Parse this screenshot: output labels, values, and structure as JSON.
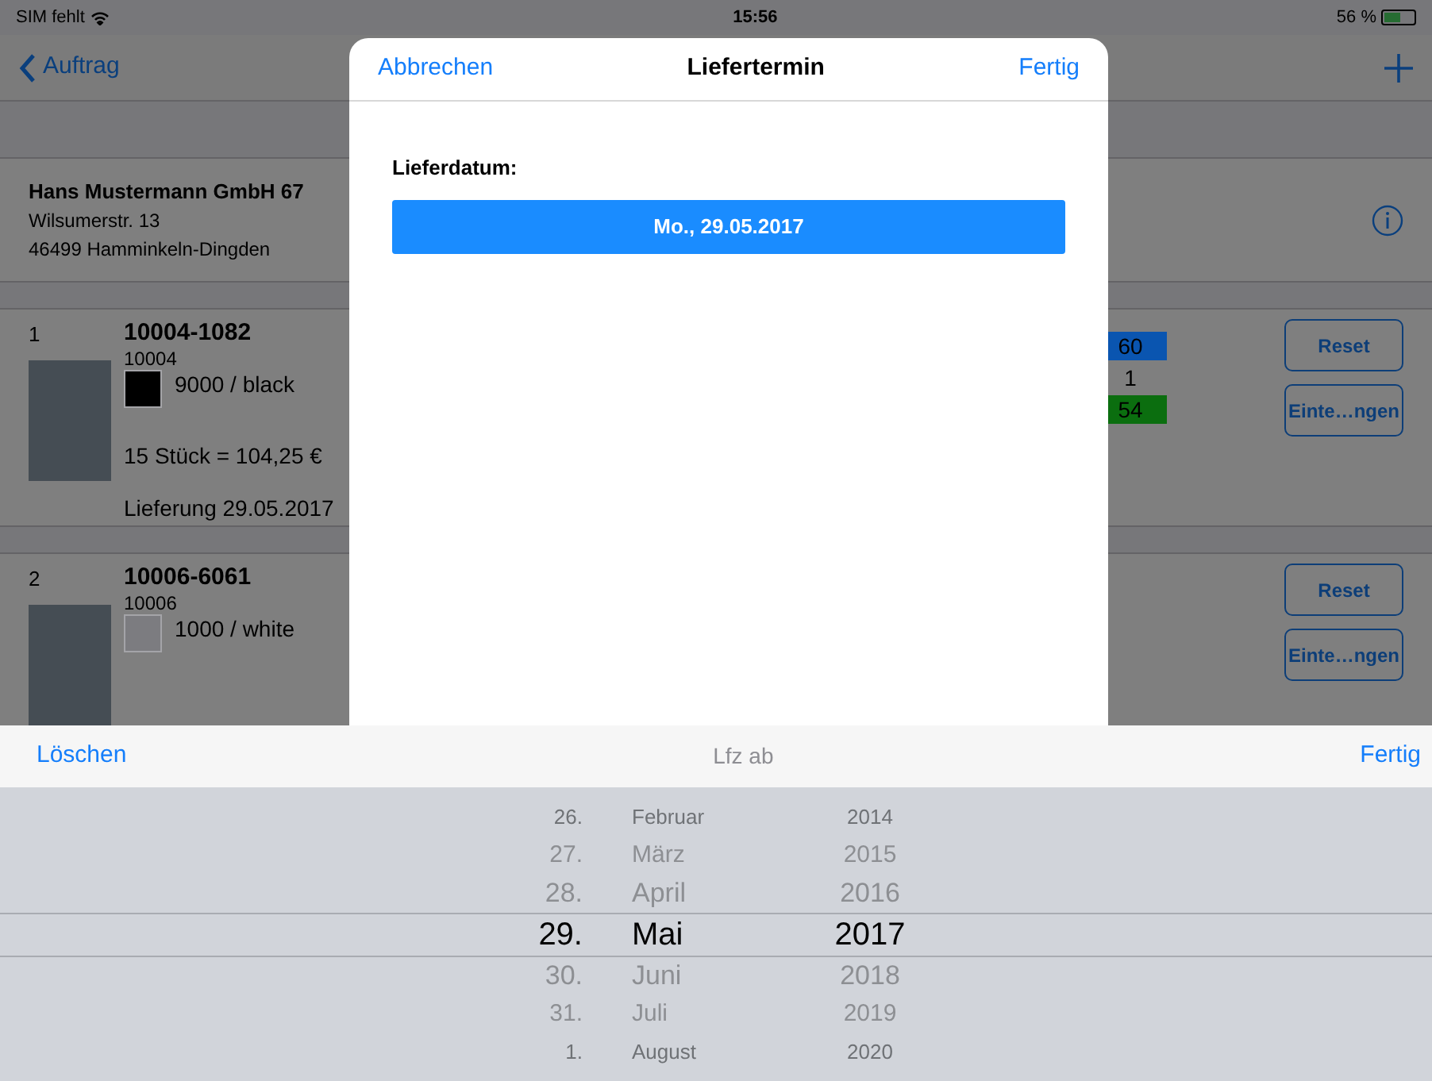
{
  "status_bar": {
    "carrier": "SIM fehlt",
    "time": "15:56",
    "battery": "56 %"
  },
  "nav": {
    "back": "Auftrag"
  },
  "customer": {
    "name": "Hans Mustermann GmbH 67",
    "street": "Wilsumerstr. 13",
    "city": "46499 Hamminkeln-Dingden"
  },
  "items": [
    {
      "index": "1",
      "article": "10004-1082",
      "number": "10004",
      "color": "#000000",
      "variant": "9000 / black",
      "quantity": "15 Stück = 104,25 €",
      "delivery": "Lieferung 29.05.2017",
      "counters": [
        {
          "value": "60",
          "color": "#0a55b0"
        },
        {
          "value": "1"
        },
        {
          "value": "54",
          "color": "#0b6e0f"
        }
      ],
      "buttons": [
        "Reset",
        "Einte…ngen"
      ]
    },
    {
      "index": "2",
      "article": "10006-6061",
      "number": "10006",
      "color": "#7c7c80",
      "variant": "1000 / white",
      "buttons": [
        "Reset",
        "Einte…ngen"
      ]
    }
  ],
  "dialog": {
    "cancel": "Abbrechen",
    "title": "Liefertermin",
    "done": "Fertig",
    "label": "Lieferdatum:",
    "date": "Mo., 29.05.2017"
  },
  "toolbar": {
    "left": "Löschen",
    "title": "Lfz ab",
    "right": "Fertig"
  },
  "picker": {
    "rows": [
      {
        "day": "26.",
        "month": "Februar",
        "year": "2014",
        "selected": false
      },
      {
        "day": "27.",
        "month": "März",
        "year": "2015",
        "selected": false
      },
      {
        "day": "28.",
        "month": "April",
        "year": "2016",
        "selected": false
      },
      {
        "day": "29.",
        "month": "Mai",
        "year": "2017",
        "selected": true
      },
      {
        "day": "30.",
        "month": "Juni",
        "year": "2018",
        "selected": false
      },
      {
        "day": "31.",
        "month": "Juli",
        "year": "2019",
        "selected": false
      },
      {
        "day": "1.",
        "month": "August",
        "year": "2020",
        "selected": false
      }
    ]
  }
}
